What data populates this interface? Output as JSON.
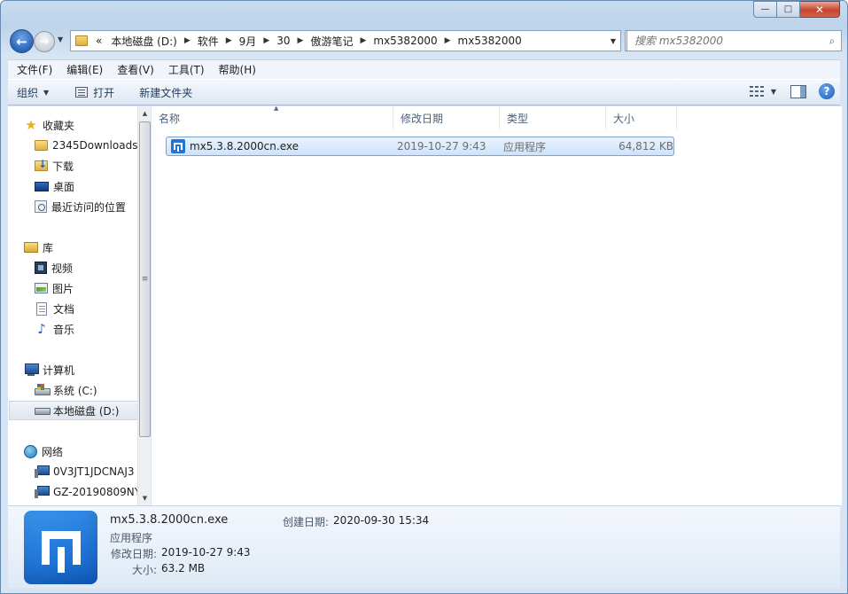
{
  "window": {
    "caption": {
      "min": "—",
      "max": "□",
      "close": "✕"
    }
  },
  "address": {
    "overflow": "«",
    "crumbs": [
      "本地磁盘 (D:)",
      "软件",
      "9月",
      "30",
      "傲游笔记",
      "mx5382000",
      "mx5382000"
    ],
    "dropdown": "▼",
    "sep": "▶"
  },
  "search": {
    "placeholder": "搜索 mx5382000"
  },
  "menu": {
    "items": [
      "文件(F)",
      "编辑(E)",
      "查看(V)",
      "工具(T)",
      "帮助(H)"
    ]
  },
  "commands": {
    "organize": "组织",
    "open": "打开",
    "new_folder": "新建文件夹"
  },
  "nav": {
    "favorites": "收藏夹",
    "downloads_2345": "2345Downloads",
    "downloads": "下载",
    "desktop": "桌面",
    "recent": "最近访问的位置",
    "libraries": "库",
    "videos": "视频",
    "pictures": "图片",
    "documents": "文档",
    "music": "音乐",
    "computer": "计算机",
    "drive_c": "系统 (C:)",
    "drive_d": "本地磁盘 (D:)",
    "network": "网络",
    "pc1": "0V3JT1JDCNAJ3",
    "pc2": "GZ-20190809NY"
  },
  "columns": {
    "name": "名称",
    "date": "修改日期",
    "type": "类型",
    "size": "大小"
  },
  "files": [
    {
      "name": "mx5.3.8.2000cn.exe",
      "date": "2019-10-27 9:43",
      "type": "应用程序",
      "size": "64,812 KB"
    }
  ],
  "details": {
    "name": "mx5.3.8.2000cn.exe",
    "type": "应用程序",
    "modified_label": "修改日期:",
    "modified": "2019-10-27 9:43",
    "size_label": "大小:",
    "size": "63.2 MB",
    "created_label": "创建日期:",
    "created": "2020-09-30 15:34"
  },
  "colors": {
    "accent": "#1f76d6",
    "selection": "#cde3fb",
    "close_button": "#c7452e"
  }
}
